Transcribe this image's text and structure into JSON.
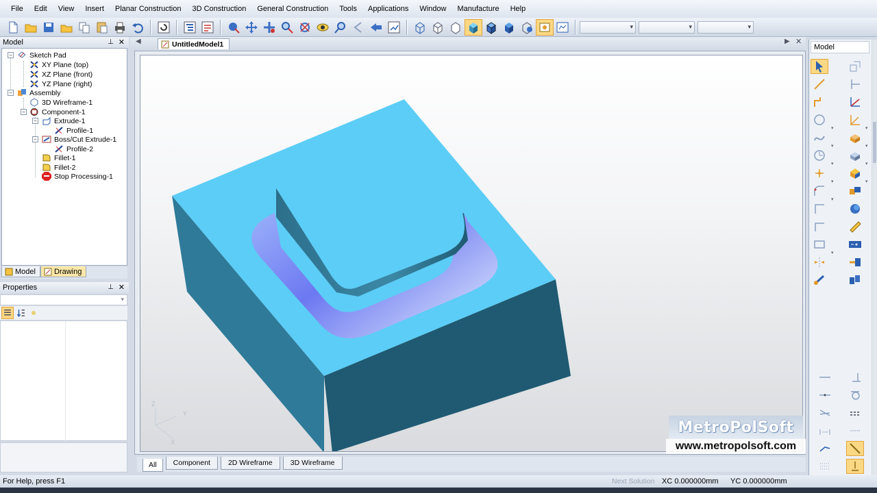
{
  "menu": [
    "File",
    "Edit",
    "View",
    "Insert",
    "Planar Construction",
    "3D Construction",
    "General Construction",
    "Tools",
    "Applications",
    "Window",
    "Manufacture",
    "Help"
  ],
  "panels": {
    "model_title": "Model",
    "properties_title": "Properties",
    "tabs": [
      "Model",
      "Drawing"
    ],
    "active_tab": "Drawing"
  },
  "tree": [
    {
      "label": "Sketch Pad",
      "icon": "sketch-pad-icon"
    },
    {
      "label": "XY Plane (top)",
      "icon": "plane-icon"
    },
    {
      "label": "XZ Plane (front)",
      "icon": "plane-icon"
    },
    {
      "label": "YZ Plane (right)",
      "icon": "plane-icon"
    },
    {
      "label": "Assembly",
      "icon": "assembly-icon"
    },
    {
      "label": "3D Wireframe-1",
      "icon": "wireframe-icon"
    },
    {
      "label": "Component-1",
      "icon": "component-icon"
    },
    {
      "label": "Extrude-1",
      "icon": "extrude-icon"
    },
    {
      "label": "Profile-1",
      "icon": "profile-icon"
    },
    {
      "label": "Boss/Cut Extrude-1",
      "icon": "boss-cut-icon"
    },
    {
      "label": "Profile-2",
      "icon": "profile-icon"
    },
    {
      "label": "Fillet-1",
      "icon": "fillet-icon"
    },
    {
      "label": "Fillet-2",
      "icon": "fillet-icon"
    },
    {
      "label": "Stop Processing-1",
      "icon": "stop-icon"
    }
  ],
  "document": {
    "tab": "UntitledModel1"
  },
  "view_tabs": [
    "All",
    "Component",
    "2D Wireframe",
    "3D Wireframe"
  ],
  "active_view_tab": "All",
  "right_panel": {
    "title": "Model"
  },
  "status": {
    "help": "For Help, press F1",
    "next_solution": "Next Solution",
    "xc": "XC  0.000000mm",
    "yc": "YC  0.000000mm"
  },
  "axis_labels": {
    "z": "Z",
    "y": "Y",
    "x": "X"
  },
  "watermark": {
    "logo": "MetroPolSoft",
    "url": "www.metropolsoft.com"
  },
  "colors": {
    "model_top": "#5ccdf6",
    "model_side": "#2e7896",
    "model_front": "#1f5a72",
    "fillet": "#7f80f0"
  }
}
